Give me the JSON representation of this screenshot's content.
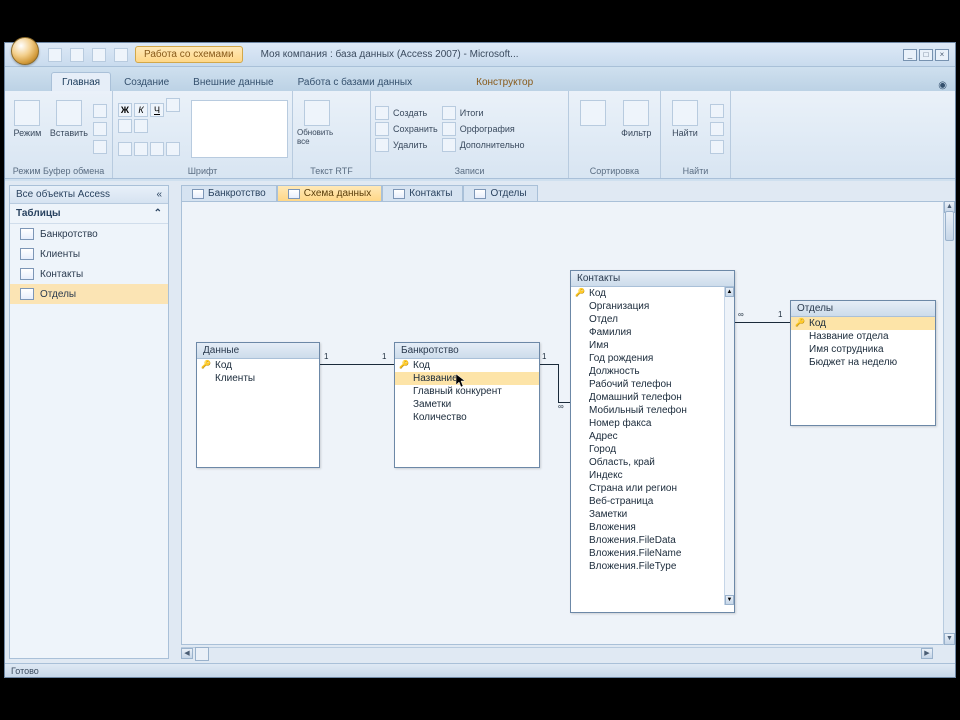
{
  "window": {
    "title": "Моя компания : база данных (Access 2007) - Microsoft...",
    "context_tab": "Работа со схемами"
  },
  "qat": {
    "icons": [
      "save-icon",
      "undo-icon",
      "redo-icon",
      "dropdown-icon"
    ]
  },
  "tabs": [
    "Главная",
    "Создание",
    "Внешние данные",
    "Работа с базами данных",
    "Конструктор"
  ],
  "tabs_active_index": 0,
  "ribbon": {
    "group1": {
      "btn1": "Режим",
      "btn2": "Вставить",
      "label": "Режим   Буфер обмена"
    },
    "group_font": {
      "btns": [
        "Ж",
        "К",
        "Ч"
      ],
      "label": "Шрифт"
    },
    "group_rich": {
      "btn": "Обновить все",
      "label": "Текст RTF"
    },
    "group_records": {
      "items": [
        "Создать",
        "Сохранить",
        "Удалить"
      ],
      "items2": [
        "Итоги",
        "Орфография",
        "Дополнительно"
      ],
      "label": "Записи"
    },
    "group_sort": {
      "label": "Сортировка"
    },
    "group_filter": {
      "btn": "Фильтр",
      "label": "Фильтр"
    },
    "group_find": {
      "btn": "Найти",
      "label": "Найти"
    }
  },
  "nav": {
    "header": "Все объекты Access",
    "category": "Таблицы",
    "items": [
      "Банкротство",
      "Клиенты",
      "Контакты",
      "Отделы"
    ],
    "selected_index": 3
  },
  "doc_tabs": [
    "Банкротство",
    "Схема данных",
    "Контакты",
    "Отделы"
  ],
  "doc_tabs_active_index": 1,
  "tables": {
    "t1": {
      "title": "Данные",
      "fields": [
        "Код",
        "Клиенты"
      ]
    },
    "t2": {
      "title": "Банкротство",
      "fields": [
        "Код",
        "Название",
        "Главный конкурент",
        "Заметки",
        "Количество"
      ],
      "sel_index": 1
    },
    "t3": {
      "title": "Контакты",
      "fields": [
        "Код",
        "Организация",
        "Отдел",
        "Фамилия",
        "Имя",
        "Год рождения",
        "Должность",
        "Рабочий телефон",
        "Домашний телефон",
        "Мобильный телефон",
        "Номер факса",
        "Адрес",
        "Город",
        "Область, край",
        "Индекс",
        "Страна или регион",
        "Веб-страница",
        "Заметки",
        "Вложения",
        "Вложения.FileData",
        "Вложения.FileName",
        "Вложения.FileType"
      ]
    },
    "t4": {
      "title": "Отделы",
      "fields": [
        "Код",
        "Название отдела",
        "Имя сотрудника",
        "Бюджет на неделю"
      ],
      "sel_index": 0
    }
  },
  "relationship_labels": {
    "one": "1",
    "many": "∞"
  },
  "statusbar": "Готово"
}
